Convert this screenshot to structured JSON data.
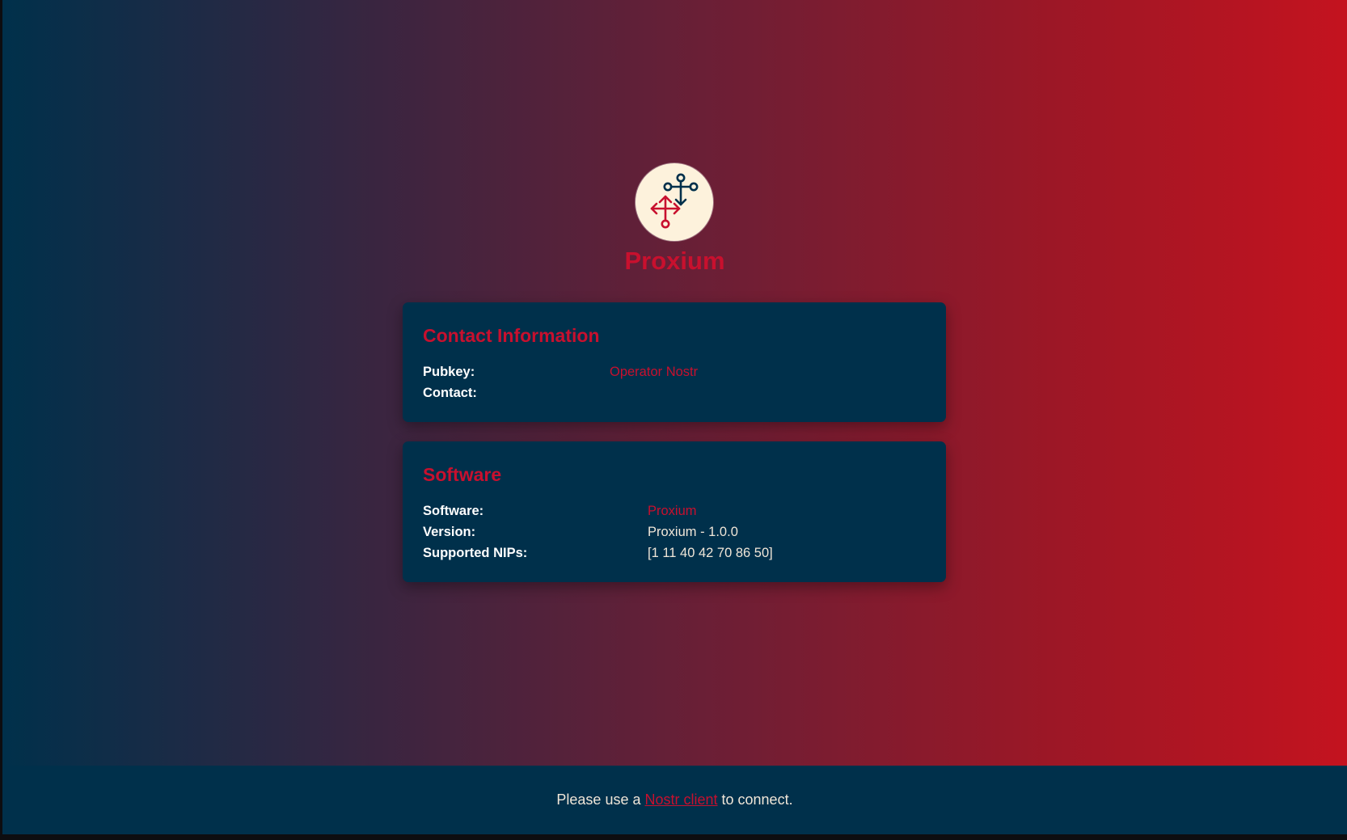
{
  "brand": {
    "name": "Proxium",
    "logo_icon": "relay-network-icon"
  },
  "contact": {
    "title": "Contact Information",
    "rows": [
      {
        "label": "Pubkey:",
        "value": "Operator Nostr"
      },
      {
        "label": "Contact:",
        "value": ""
      }
    ]
  },
  "software": {
    "title": "Software",
    "rows": [
      {
        "label": "Software:",
        "value": "Proxium"
      },
      {
        "label": "Version:",
        "value": "Proxium - 1.0.0"
      },
      {
        "label": "Supported NIPs:",
        "value": "[1 11 40 42 70 86 50]"
      }
    ]
  },
  "footer": {
    "prefix": "Please use a ",
    "link_text": "Nostr client",
    "suffix": " to connect."
  },
  "colors": {
    "accent": "#c8102e",
    "navy": "#00304b",
    "cream": "#fdf2dc"
  }
}
